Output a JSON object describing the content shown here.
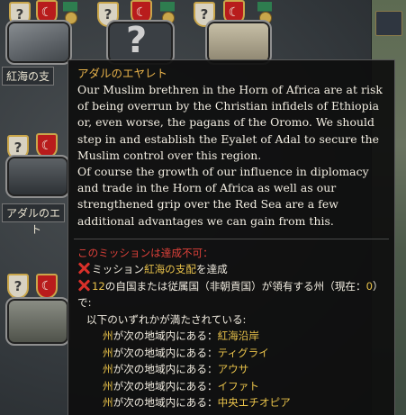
{
  "background": {
    "node_labels": [
      "紅海の支",
      "アダルのエ",
      "ト"
    ]
  },
  "tooltip": {
    "title": "アダルのエヤレト",
    "description": [
      "Our Muslim brethren in the Horn of Africa are at risk",
      "of being overrun by the Christian infidels of Ethiopia",
      "or, even worse, the pagans of the Oromo. We should",
      "step in and establish the Eyalet of Adal to secure the",
      "Muslim control over this region.",
      "Of course the growth of our influence in diplomacy",
      "and trade in the Horn of Africa as well as our",
      "strengthened grip over the Red Sea are a few",
      "additional advantages we can gain from this."
    ],
    "unavailable": "このミッションは達成不可：",
    "req1": {
      "prefix": "ミッション",
      "mission": "紅海の支配",
      "suffix": "を達成"
    },
    "req2": {
      "count": "12",
      "text": "の自国または従属国（非朝貢国）が領有する州（現在：",
      "current": "0",
      "close": "）"
    },
    "req2_tail": "で:",
    "any_of": "以下のいずれかが満たされている:",
    "areas": [
      {
        "subject": "州",
        "text": "が次の地域内にある：",
        "area": "紅海沿岸"
      },
      {
        "subject": "州",
        "text": "が次の地域内にある：",
        "area": "ティグライ"
      },
      {
        "subject": "州",
        "text": "が次の地域内にある：",
        "area": "アウサ"
      },
      {
        "subject": "州",
        "text": "が次の地域内にある：",
        "area": "イファト"
      },
      {
        "subject": "州",
        "text": "が次の地域内にある：",
        "area": "中央エチオピア"
      }
    ]
  },
  "icons": {
    "unknown": "question-mark-badge-icon",
    "religion": "crescent-badge-icon",
    "reward": "medal-icon",
    "failed": "red-x-icon"
  },
  "colors": {
    "title": "#e8b24a",
    "highlight": "#e9c24a",
    "error": "#e0413a",
    "panel": "#0e0e0e"
  }
}
